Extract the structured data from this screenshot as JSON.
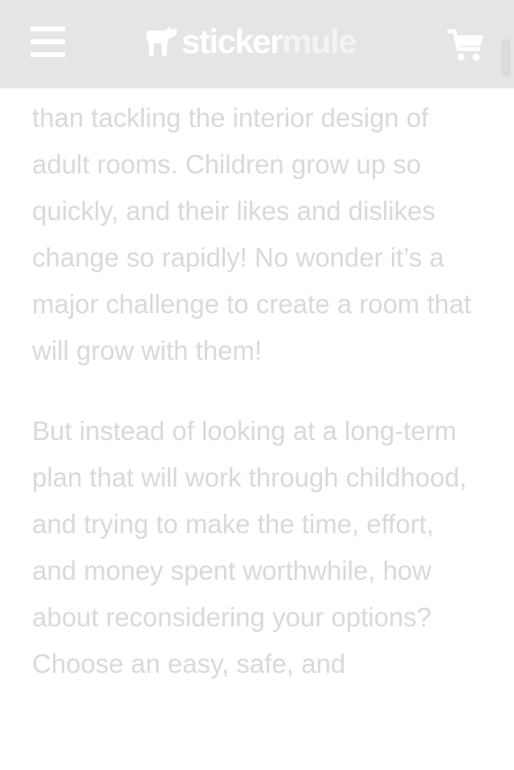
{
  "header": {
    "menu_icon": "hamburger-menu-icon",
    "logo": {
      "word_sticker": "sticker",
      "word_mule": "mule",
      "icon": "mule-icon"
    },
    "cart_icon": "shopping-cart-icon",
    "background_color": "#e1e1e1"
  },
  "article": {
    "text_color": "#d9d9d9",
    "paragraphs": [
      "than tackling the interior design of adult rooms. Children grow up so quickly, and their likes and dislikes change so rapidly! No wonder it’s a major challenge to create a room that will grow with them!",
      "But instead of looking at a long-term plan that will work through childhood, and trying to make the time, effort, and money spent worthwhile, how about reconsidering your options? Choose an easy, safe, and"
    ]
  }
}
